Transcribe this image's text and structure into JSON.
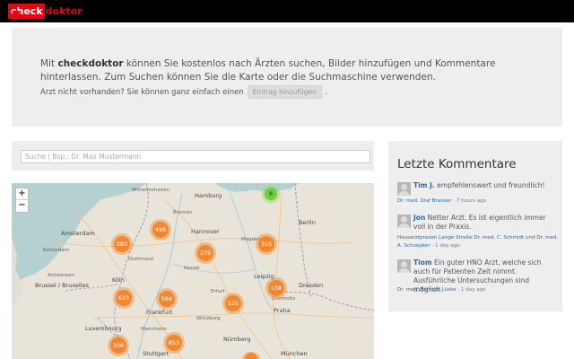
{
  "header": {
    "logo_check": "check",
    "logo_doktor": "doktor"
  },
  "intro": {
    "text_prefix": "Mit ",
    "brand": "checkdoktor",
    "text_suffix": " können Sie kostenlos nach Ärzten suchen, Bilder hinzufügen und Kommentare hinterlassen. Zum Suchen können Sie die Karte oder die Suchmaschine verwenden.",
    "not_found": "Arzt nicht vorhanden? Sie können ganz einfach einen",
    "add_button": "Eintrag hinzufügen",
    "dot": "."
  },
  "search": {
    "placeholder": "Suche | Bsp.: Dr. Max Mustermann"
  },
  "map": {
    "zoom_in": "+",
    "zoom_out": "−",
    "clusters": [
      "8",
      "496",
      "283",
      "379",
      "315",
      "623",
      "564",
      "525",
      "138",
      "106",
      "853"
    ],
    "labels": {
      "amsterdam": "Amsterdam",
      "brussel": "Brussel / Bruxelles",
      "luxembourg": "Luxembourg",
      "praha": "Praha",
      "hamburg": "Hamburg",
      "bremen": "Bremen",
      "hannover": "Hannover",
      "berlin": "Berlin",
      "leipzig": "Leipzig",
      "dresden": "Dresden",
      "koeln": "Köln",
      "frankfurt": "Frankfurt",
      "nuernberg": "Nürnberg",
      "muenchen": "München",
      "stuttgart": "Stuttgart",
      "rotterdam": "Rotterdam",
      "antwerpen": "Antwerpen",
      "wilhelmshaven": "Wilhelmshaven",
      "kassel": "Kassel",
      "magdeburg": "Magdeburg",
      "erfurt": "Erfurt",
      "chemnitz": "Chemnitz",
      "dortmund": "Dortmund",
      "mannheim": "Mannheim",
      "wuerzburg": "Würzburg"
    }
  },
  "comments": {
    "title": "Letzte Kommentare",
    "items": [
      {
        "author": "Tim J.",
        "text": " empfehlenswert und freundlich!",
        "doctor": "Dr. med. Olaf Brauser",
        "time": " · 7 hours ago"
      },
      {
        "author": "Jon",
        "text": " Netter Arzt. Es ist eigentlich immer voll in der Praxis.",
        "doctor": "Hausarztpraxen Lange Straße Dr. med. C. Schmidt und Dr. med. A. Schoepker",
        "time": " · 1 day ago"
      },
      {
        "author": "Tiom",
        "text": " Ein guter HNO Arzt, welche sich auch für Patienten Zeit nimmt. Ausführliche Untersuchungen sind möglich.",
        "doctor": "Dr. med. Bernard Lüske",
        "time": " · 1 day ago"
      }
    ]
  },
  "colors": {
    "brand_red": "#e30613",
    "link_blue": "#2a6aa8",
    "cluster_orange": "#f08228",
    "cluster_green": "#6ec83c"
  }
}
